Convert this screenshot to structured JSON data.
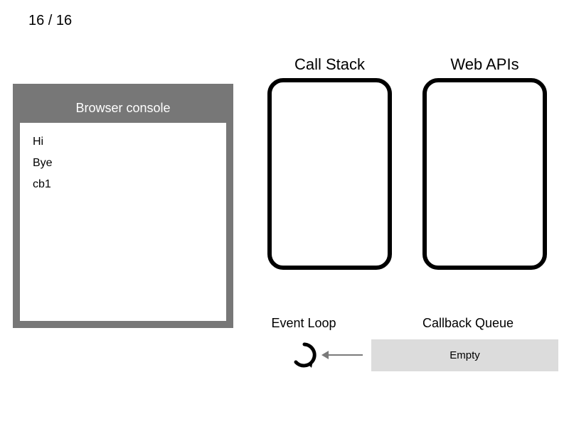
{
  "step": {
    "current": 16,
    "total": 16,
    "display": "16 / 16"
  },
  "console": {
    "title": "Browser console",
    "lines": [
      "Hi",
      "Bye",
      "cb1"
    ]
  },
  "labels": {
    "call_stack": "Call Stack",
    "web_apis": "Web APIs",
    "event_loop": "Event Loop",
    "callback_queue": "Callback Queue"
  },
  "call_stack": {
    "items": []
  },
  "web_apis": {
    "items": []
  },
  "callback_queue": {
    "state": "Empty",
    "items": []
  }
}
